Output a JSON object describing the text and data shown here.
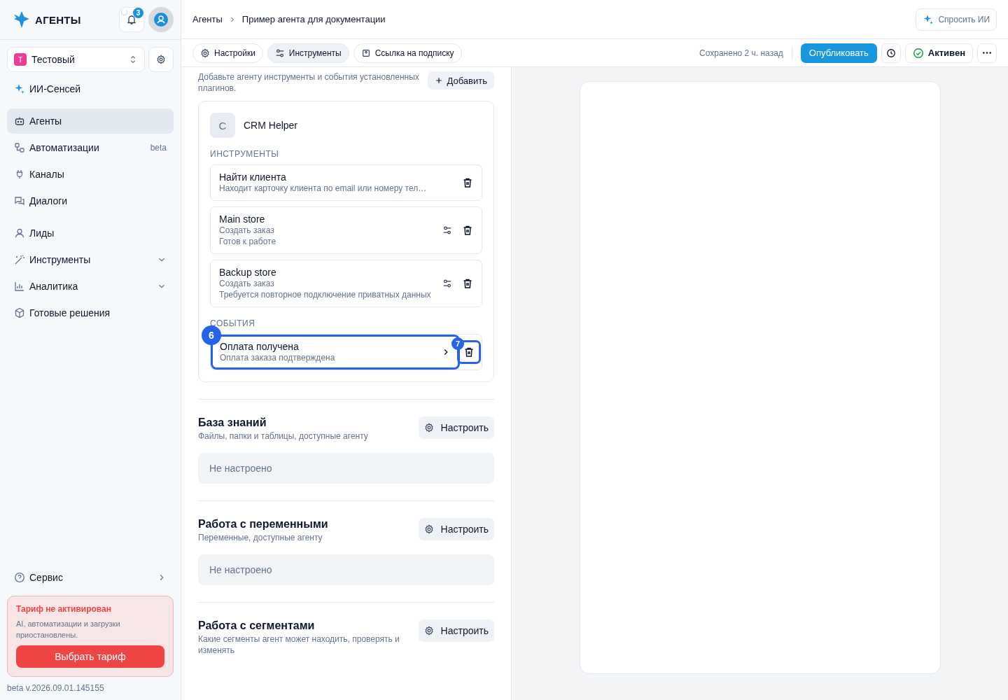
{
  "brand": {
    "name": "АГЕНТЫ"
  },
  "notifications": {
    "count": "3"
  },
  "workspace": {
    "initial": "Т",
    "name": "Тестовый",
    "color": "#ec3d96"
  },
  "sidebar": {
    "items": [
      {
        "label": "ИИ-Сенсей",
        "selected": false,
        "expandable": false
      },
      {
        "label": "Агенты",
        "selected": true,
        "expandable": false
      },
      {
        "label": "Автоматизации",
        "selected": false,
        "expandable": false,
        "badge": "beta"
      },
      {
        "label": "Каналы",
        "selected": false,
        "expandable": false
      },
      {
        "label": "Диалоги",
        "selected": false,
        "expandable": false
      },
      {
        "label": "Лиды",
        "selected": false,
        "expandable": false
      },
      {
        "label": "Инструменты",
        "selected": false,
        "expandable": true
      },
      {
        "label": "Аналитика",
        "selected": false,
        "expandable": true
      },
      {
        "label": "Готовые решения",
        "selected": false,
        "expandable": false
      }
    ],
    "service": {
      "label": "Сервис"
    },
    "plan_alert": {
      "title": "Тариф не активирован",
      "text": "AI, автоматизации и загрузки приостановлены.",
      "button": "Выбрать тариф"
    },
    "version": "beta v.2026.09.01.145155"
  },
  "breadcrumbs": [
    "Агенты",
    "Пример агента для документации"
  ],
  "ask_ai": "Спросить ИИ",
  "toolbar": {
    "tabs": [
      {
        "label": "Настройки",
        "selected": false
      },
      {
        "label": "Инструменты",
        "selected": true
      },
      {
        "label": "Ссылка на подписку",
        "selected": false
      }
    ],
    "saved": "Сохранено 2 ч. назад",
    "publish": "Опубликовать",
    "status": "Активен",
    "active": true
  },
  "tools_section": {
    "description": "Добавьте агенту инструменты и события установленных плагинов.",
    "add_button": "Добавить",
    "plugin": {
      "initial": "C",
      "name": "CRM Helper"
    },
    "tools_heading": "ИНСТРУМЕНТЫ",
    "tools": [
      {
        "title": "Найти клиента",
        "lines": [
          "Находит карточку клиента по email или номеру тел…"
        ],
        "configurable": false
      },
      {
        "title": "Main store",
        "lines": [
          "Создать заказ",
          "Готов к работе"
        ],
        "configurable": true
      },
      {
        "title": "Backup store",
        "lines": [
          "Создать заказ",
          "Требуется повторное подключение приватных данных"
        ],
        "configurable": true
      }
    ],
    "events_heading": "СОБЫТИЯ",
    "events": [
      {
        "title": "Оплата получена",
        "subtitle": "Оплата заказа подтверждена",
        "marker": "6",
        "delete_marker": "7"
      }
    ]
  },
  "sections": [
    {
      "title": "База знаний",
      "subtitle": "Файлы, папки и таблицы, доступные агенту",
      "button": "Настроить",
      "empty": "Не настроено"
    },
    {
      "title": "Работа с переменными",
      "subtitle": "Переменные, доступные агенту",
      "button": "Настроить",
      "empty": "Не настроено"
    },
    {
      "title": "Работа с сегментами",
      "subtitle": "Какие сегменты агент может находить, проверять и изменять",
      "button": "Настроить"
    }
  ]
}
